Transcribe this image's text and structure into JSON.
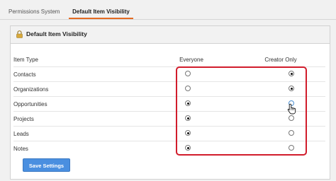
{
  "tabs": [
    {
      "label": "Permissions System"
    },
    {
      "label": "Default Item Visibility"
    }
  ],
  "accent": "#e36b22",
  "panel": {
    "title": "Default Item Visibility",
    "icon": "lock-icon"
  },
  "table": {
    "headers": {
      "type": "Item Type",
      "everyone": "Everyone",
      "creator": "Creator Only"
    },
    "rows": [
      {
        "label": "Contacts",
        "selected": "creator"
      },
      {
        "label": "Organizations",
        "selected": "creator"
      },
      {
        "label": "Opportunities",
        "selected": "everyone"
      },
      {
        "label": "Projects",
        "selected": "everyone"
      },
      {
        "label": "Leads",
        "selected": "everyone"
      },
      {
        "label": "Notes",
        "selected": "everyone"
      }
    ]
  },
  "highlight_color": "#d11c2b",
  "button": {
    "label": "Save Settings",
    "color": "#4a8fe0"
  },
  "cursor_icon": "hand-pointer-icon"
}
